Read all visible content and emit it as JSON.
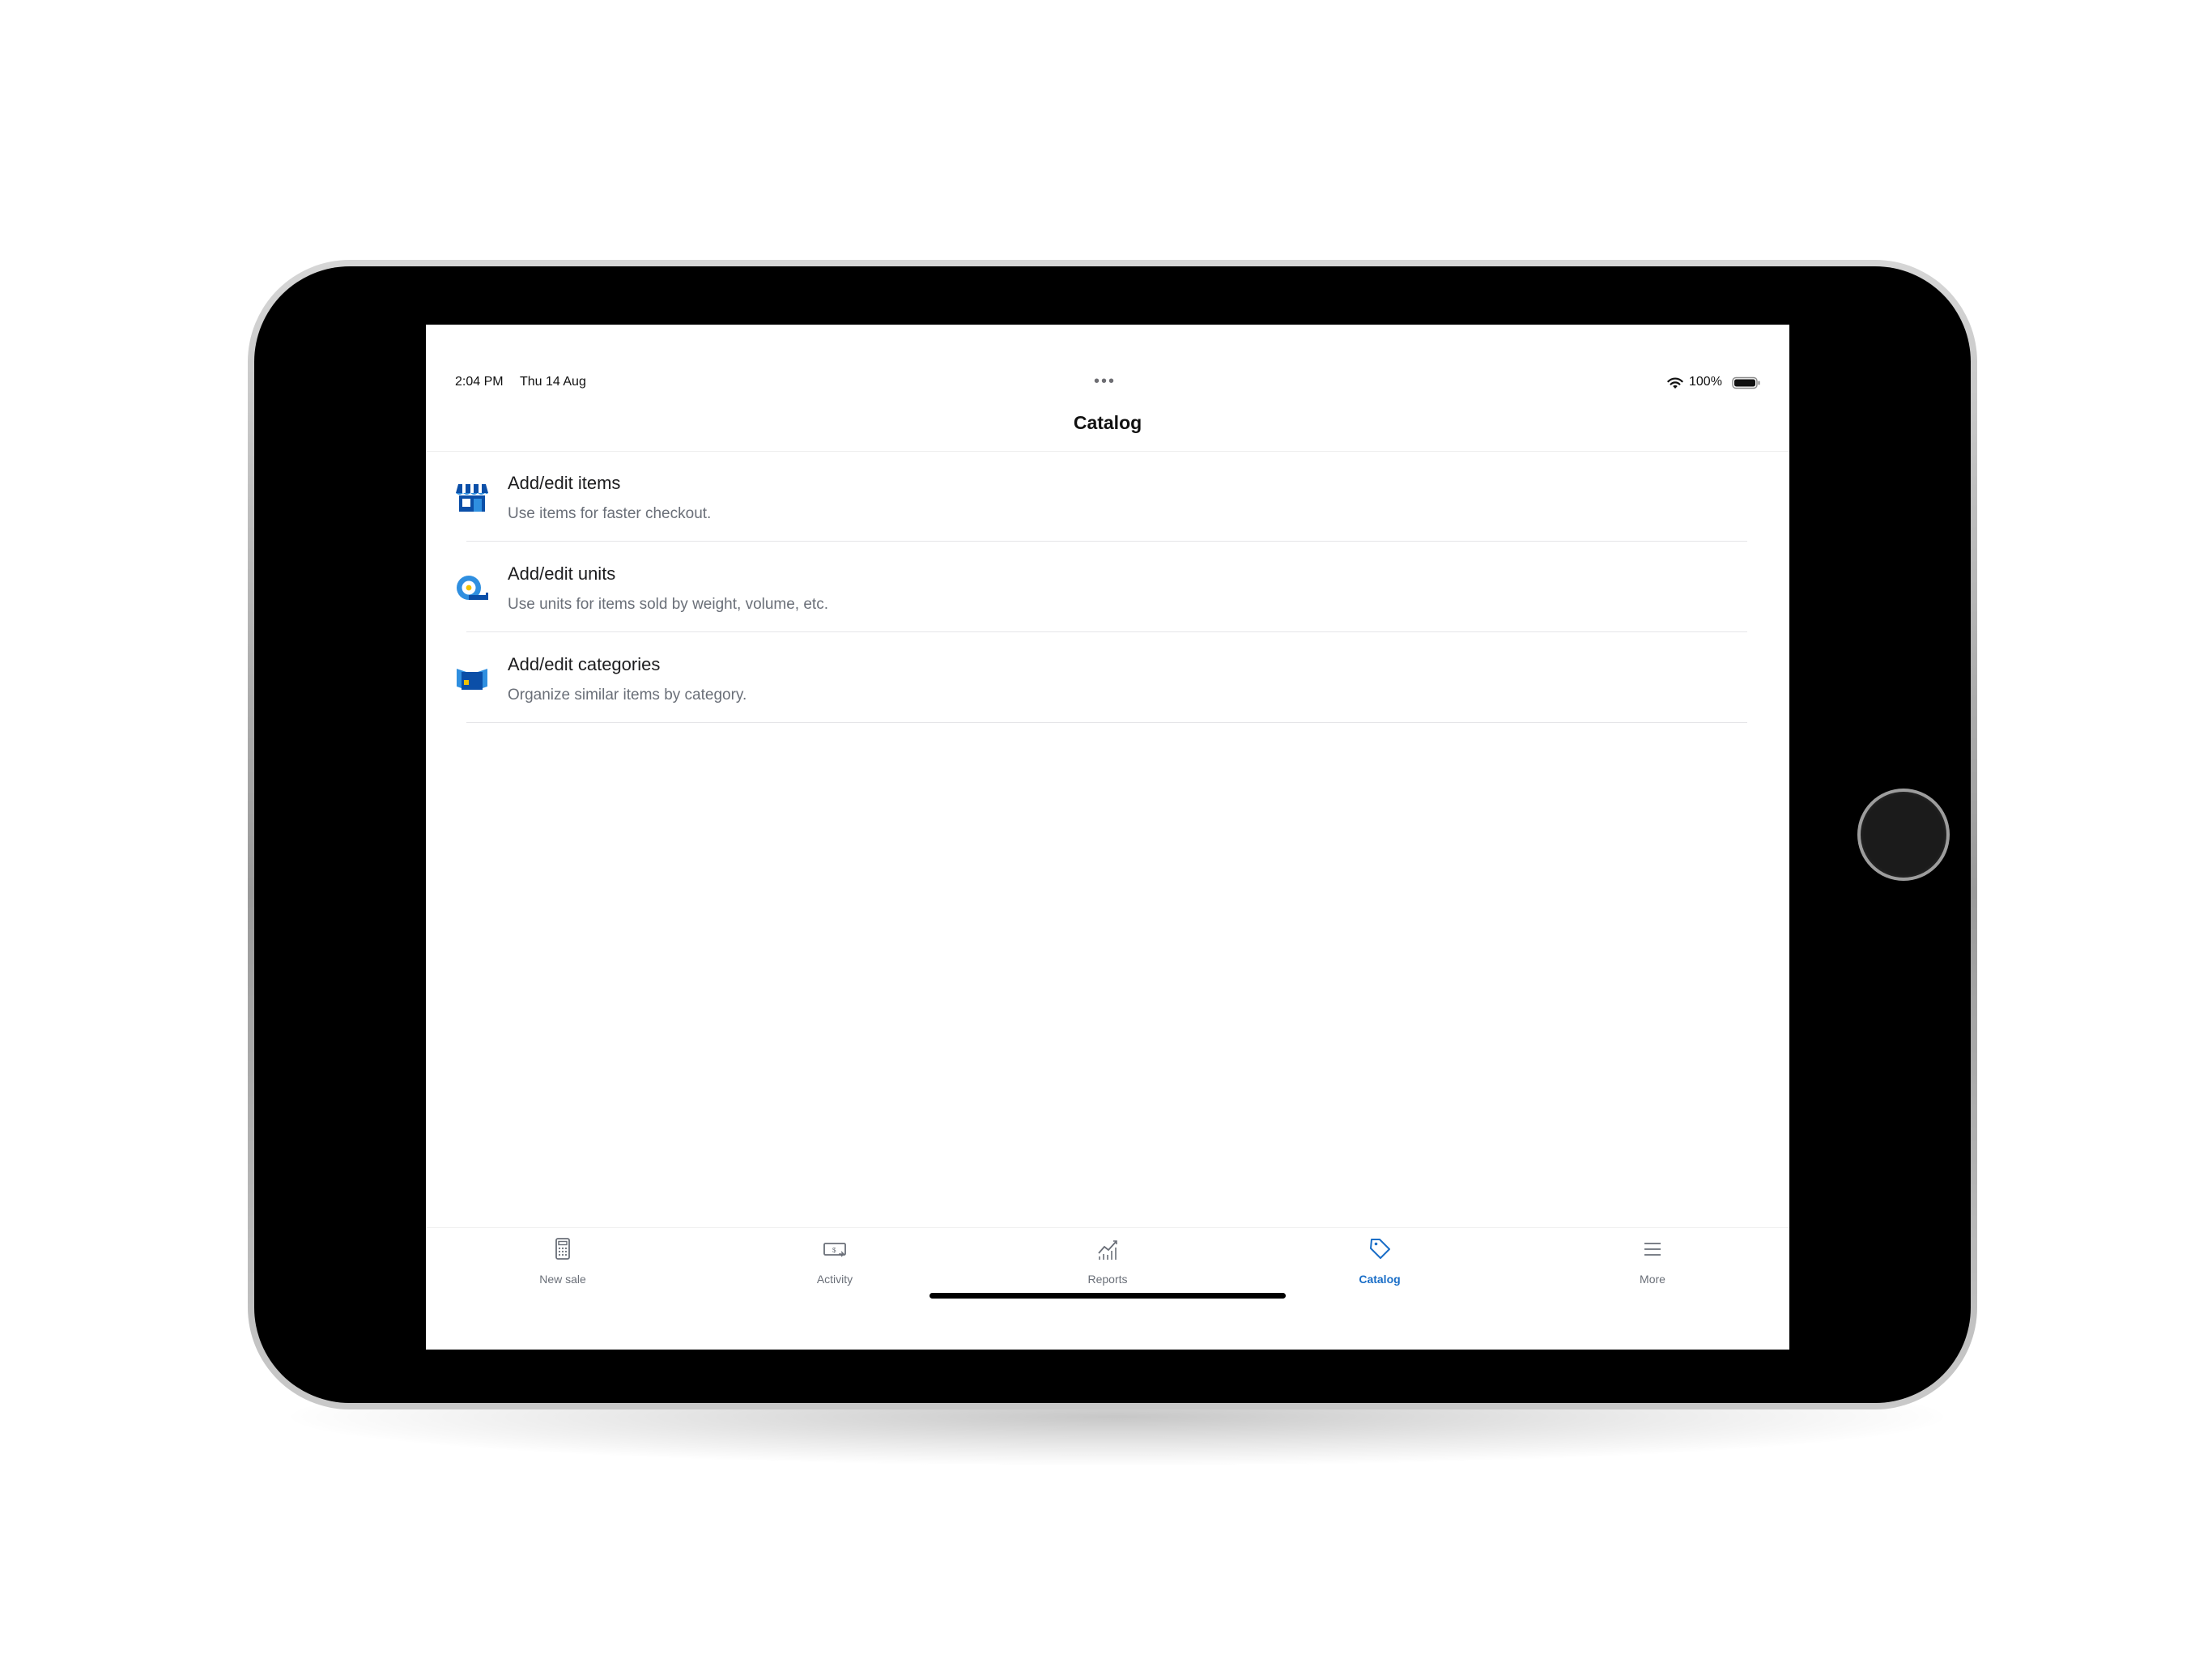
{
  "status_bar": {
    "time": "2:04 PM",
    "date": "Thu 14 Aug",
    "multitask_indicator": "•••",
    "battery_percent": "100%"
  },
  "header": {
    "title": "Catalog"
  },
  "catalog_rows": [
    {
      "title": "Add/edit items",
      "subtitle": "Use items for faster checkout.",
      "icon": "storefront-icon"
    },
    {
      "title": "Add/edit units",
      "subtitle": "Use units for items sold by weight, volume, etc.",
      "icon": "tape-measure-icon"
    },
    {
      "title": "Add/edit categories",
      "subtitle": "Organize similar items by category.",
      "icon": "open-box-icon"
    }
  ],
  "tab_bar": {
    "items": [
      {
        "label": "New sale",
        "icon": "calculator-icon",
        "active": false
      },
      {
        "label": "Activity",
        "icon": "receipt-icon",
        "active": false
      },
      {
        "label": "Reports",
        "icon": "line-chart-icon",
        "active": false
      },
      {
        "label": "Catalog",
        "icon": "tag-icon",
        "active": true
      },
      {
        "label": "More",
        "icon": "menu-icon",
        "active": false
      }
    ]
  },
  "colors": {
    "accent": "#1a6ec7",
    "icon_blue_dark": "#0b4fa8",
    "icon_blue_light": "#2f8fe0",
    "text_primary": "#1c1c1e",
    "text_secondary": "#6a6f78"
  }
}
